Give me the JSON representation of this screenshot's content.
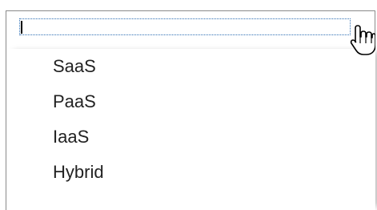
{
  "combo": {
    "value": "",
    "selected": ""
  },
  "options": [
    {
      "label": "SaaS"
    },
    {
      "label": "PaaS"
    },
    {
      "label": "IaaS"
    },
    {
      "label": "Hybrid"
    }
  ],
  "icons": {
    "dropdown": "chevron-down-icon",
    "cursor": "hand-pointer-icon"
  },
  "colors": {
    "focus_border": "#2f6fb3",
    "border": "#8a8a8a",
    "text": "#222222"
  }
}
